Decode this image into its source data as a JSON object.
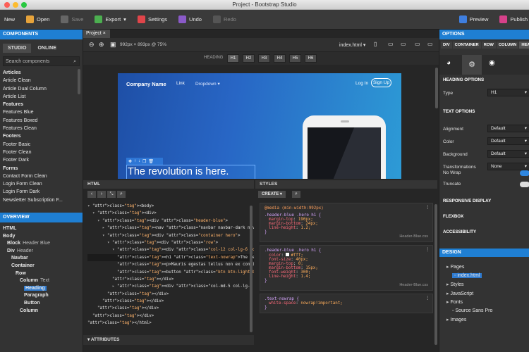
{
  "window": {
    "title": "Project - Bootstrap Studio"
  },
  "toolbar": {
    "new": "New",
    "open": "Open",
    "save": "Save",
    "export": "Export",
    "settings": "Settings",
    "undo": "Undo",
    "redo": "Redo",
    "preview": "Preview",
    "publish": "Publish"
  },
  "left_panel": {
    "components_title": "COMPONENTS",
    "tab_studio": "STUDIO",
    "tab_online": "ONLINE",
    "search_placeholder": "Search components",
    "items": [
      {
        "label": "Articles",
        "cat": true
      },
      {
        "label": "Article Clean",
        "cat": false
      },
      {
        "label": "Article Dual Column",
        "cat": false
      },
      {
        "label": "Article List",
        "cat": false
      },
      {
        "label": "Features",
        "cat": true
      },
      {
        "label": "Features Blue",
        "cat": false
      },
      {
        "label": "Features Boxed",
        "cat": false
      },
      {
        "label": "Features Clean",
        "cat": false
      },
      {
        "label": "Footers",
        "cat": true
      },
      {
        "label": "Footer Basic",
        "cat": false
      },
      {
        "label": "Footer Clean",
        "cat": false
      },
      {
        "label": "Footer Dark",
        "cat": false
      },
      {
        "label": "Forms",
        "cat": true
      },
      {
        "label": "Contact Form Clean",
        "cat": false
      },
      {
        "label": "Login Form Clean",
        "cat": false
      },
      {
        "label": "Login Form Dark",
        "cat": false
      },
      {
        "label": "Newsletter Subscription F...",
        "cat": false
      }
    ],
    "overview_title": "OVERVIEW",
    "overview": [
      {
        "name": "HTML",
        "sub": "",
        "indent": 0
      },
      {
        "name": "Body",
        "sub": "",
        "indent": 0
      },
      {
        "name": "Block",
        "sub": "Header Blue",
        "indent": 1
      },
      {
        "name": "Div",
        "sub": "Header",
        "indent": 1
      },
      {
        "name": "Navbar",
        "sub": "",
        "indent": 2
      },
      {
        "name": "Container",
        "sub": "",
        "indent": 2
      },
      {
        "name": "Row",
        "sub": "",
        "indent": 3
      },
      {
        "name": "Column",
        "sub": "Text",
        "indent": 4
      },
      {
        "name": "Heading",
        "sub": "",
        "indent": 5
      },
      {
        "name": "Paragraph",
        "sub": "",
        "indent": 5
      },
      {
        "name": "Button",
        "sub": "",
        "indent": 5
      },
      {
        "name": "Column",
        "sub": "",
        "indent": 4
      }
    ]
  },
  "center": {
    "doc_tab": "Project",
    "size_readout": "992px × 893px @ 75%",
    "page_select": "index.html",
    "heading_label": "HEADING",
    "heading_buttons": [
      "H1",
      "H2",
      "H3",
      "H4",
      "H5",
      "H6"
    ],
    "preview": {
      "brand": "Company Name",
      "link": "Link",
      "dropdown": "Dropdown",
      "login": "Log In",
      "signup": "Sign Up",
      "headline": "The revolution is here."
    }
  },
  "html_pane": {
    "title": "HTML",
    "lines": [
      {
        "indent": 0,
        "text": "<body>"
      },
      {
        "indent": 1,
        "text": "<div>"
      },
      {
        "indent": 2,
        "text": "<div class=\"header-blue\">"
      },
      {
        "indent": 3,
        "text": "<nav class=\"navbar navbar-dark navbar-expand-md navigatio"
      },
      {
        "indent": 3,
        "text": "<div class=\"container hero\">"
      },
      {
        "indent": 4,
        "text": "<div class=\"row\">"
      },
      {
        "indent": 5,
        "text": "<div class=\"col-12 col-lg-6 col-xl-5 offset-xl-1\">"
      },
      {
        "indent": 6,
        "text": "<h1 class=\"text-nowrap\">The revolution is here.</h1>"
      },
      {
        "indent": 6,
        "text": "<p>Mauris egestas tellus non ex condimentum, ac ulla"
      },
      {
        "indent": 6,
        "text": "<button class=\"btn btn-light btn-lg action-button\" type="
      },
      {
        "indent": 5,
        "text": "</div>"
      },
      {
        "indent": 5,
        "text": "<div class=\"col-md-5 col-lg-5 offset-lg-1 offset-xl-0 d-non"
      },
      {
        "indent": 4,
        "text": "</div>"
      },
      {
        "indent": 3,
        "text": "</div>"
      },
      {
        "indent": 2,
        "text": "</div>"
      },
      {
        "indent": 1,
        "text": "</div>"
      },
      {
        "indent": 0,
        "text": "</html>"
      }
    ],
    "attributes_label": "ATTRIBUTES"
  },
  "styles_pane": {
    "title": "STYLES",
    "create_label": "CREATE",
    "blocks": [
      {
        "media": "@media (min-width:992px)",
        "selector": ".header-blue .hero h1 {",
        "props": [
          [
            "margin-top",
            "190px;"
          ],
          [
            "margin-bottom",
            "24px;"
          ],
          [
            "line-height",
            "1.2;"
          ]
        ],
        "source": "Header-Blue.css"
      },
      {
        "media": "",
        "selector": ".header-blue .hero h1 {",
        "props": [
          [
            "color",
            "#fff;"
          ],
          [
            "font-size",
            "40px;"
          ],
          [
            "margin-top",
            "0;"
          ],
          [
            "margin-bottom",
            "15px;"
          ],
          [
            "font-weight",
            "300;"
          ],
          [
            "line-height",
            "1.4;"
          ]
        ],
        "source": "Header-Blue.css"
      },
      {
        "media": "",
        "selector": ".text-nowrap {",
        "props": [
          [
            "white-space",
            "nowrap!important;"
          ]
        ],
        "source": ""
      }
    ]
  },
  "right_panel": {
    "options_title": "OPTIONS",
    "tabs": [
      "DIV",
      "CONTAINER",
      "ROW",
      "COLUMN",
      "HEA"
    ],
    "heading_options": "HEADING OPTIONS",
    "type_label": "Type",
    "type_value": "H1",
    "text_options": "TEXT OPTIONS",
    "rows": [
      {
        "label": "Alignment",
        "value": "Default"
      },
      {
        "label": "Color",
        "value": "Default"
      },
      {
        "label": "Background",
        "value": "Default"
      },
      {
        "label": "Transformations",
        "value": "None"
      }
    ],
    "no_wrap": "No Wrap",
    "truncate": "Truncate",
    "responsive": "RESPONSIVE DISPLAY",
    "flexbox": "FLEXBOX",
    "accessibility": "ACCESSIBILITY",
    "design_title": "DESIGN",
    "design_tree": [
      {
        "label": "Pages",
        "indent": 0
      },
      {
        "label": "index.html",
        "indent": 1,
        "selected": true
      },
      {
        "label": "Styles",
        "indent": 0
      },
      {
        "label": "JavaScript",
        "indent": 0
      },
      {
        "label": "Fonts",
        "indent": 0
      },
      {
        "label": "Source Sans Pro",
        "indent": 1
      },
      {
        "label": "Images",
        "indent": 0
      }
    ]
  },
  "colors": {
    "accent": "#1f7fd3",
    "toolbar": "#3a3a3a",
    "panel": "#333333"
  }
}
